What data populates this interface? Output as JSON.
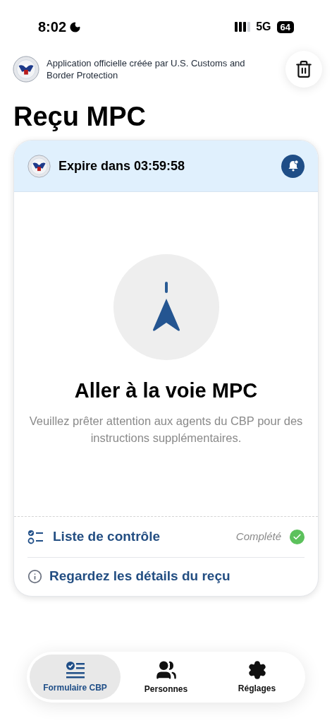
{
  "status_bar": {
    "time": "8:02",
    "network": "5G",
    "battery": "64"
  },
  "header": {
    "notice": "Application officielle créée par U.S. Customs and Border Protection"
  },
  "title": "Reçu MPC",
  "card": {
    "expiry": "Expire dans 03:59:58",
    "heading": "Aller à la voie MPC",
    "message": "Veuillez prêter attention aux agents du CBP pour des instructions supplémentaires.",
    "checklist": {
      "label": "Liste de contrôle",
      "status": "Complété",
      "completed": true
    },
    "details_link": "Regardez les détails du reçu"
  },
  "tabs": [
    {
      "label": "Formulaire CBP",
      "kind": "form",
      "selected": true
    },
    {
      "label": "Personnes",
      "kind": "people",
      "selected": false
    },
    {
      "label": "Réglages",
      "kind": "settings",
      "selected": false
    }
  ]
}
